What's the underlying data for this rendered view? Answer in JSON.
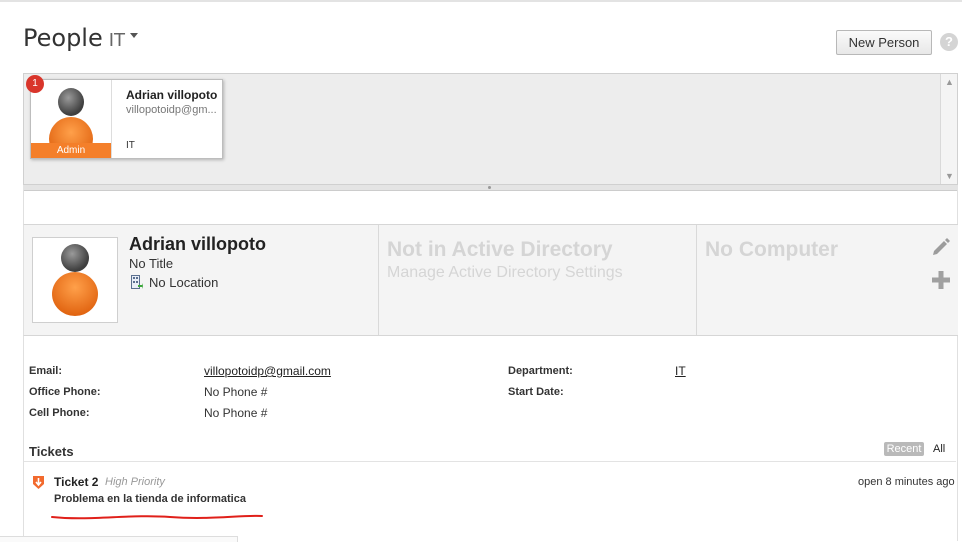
{
  "header": {
    "title": "People",
    "group": "IT",
    "new_person_label": "New Person",
    "help_label": "?"
  },
  "people_list": [
    {
      "badge": "1",
      "role": "Admin",
      "name": "Adrian villopoto",
      "email": "villopotoidp@gm...",
      "department": "IT"
    }
  ],
  "person": {
    "name": "Adrian villopoto",
    "title": "No Title",
    "location": "No Location",
    "ad_status": "Not in Active Directory",
    "ad_link": "Manage Active Directory Settings",
    "computer_status": "No Computer"
  },
  "fields": {
    "email_label": "Email:",
    "email_value": "villopotoidp@gmail.com",
    "office_phone_label": "Office Phone:",
    "office_phone_value": "No Phone #",
    "cell_phone_label": "Cell Phone:",
    "cell_phone_value": "No Phone #",
    "department_label": "Department:",
    "department_value": "IT",
    "start_date_label": "Start Date:",
    "start_date_value": ""
  },
  "tickets": {
    "heading": "Tickets",
    "filter_recent": "Recent",
    "filter_all": "All",
    "items": [
      {
        "number": "Ticket 2",
        "priority": "High Priority",
        "subject": "Problema en la tienda de informatica",
        "status": "open 8 minutes ago"
      }
    ]
  },
  "colors": {
    "accent_orange": "#f47f2a",
    "badge_red": "#d9352b",
    "annotation_red": "#e0201a"
  }
}
